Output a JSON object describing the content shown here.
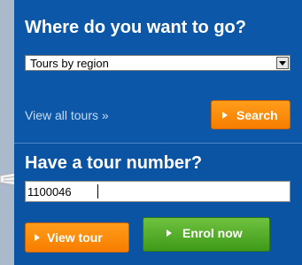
{
  "search": {
    "heading": "Where do you want to go?",
    "region_select": {
      "value": "Tours by region"
    },
    "view_all_link": "View all tours »",
    "search_button": "Search"
  },
  "tour_number": {
    "heading": "Have a tour number?",
    "input_value": "1100046",
    "view_tour_button": "View tour",
    "enrol_button": "Enrol now"
  },
  "colors": {
    "panel_blue": "#0c57a8",
    "orange_button": "#f77d00",
    "green_button": "#3f9a19"
  }
}
